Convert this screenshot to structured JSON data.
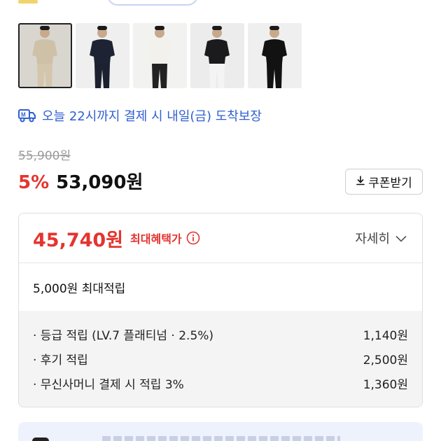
{
  "product": {
    "thumbnails": [
      {
        "name": "thumbnail-1",
        "selected": true,
        "shirt": "#cfc1a8",
        "pants": "#d3c6ad",
        "bg": "#d9d6cf"
      },
      {
        "name": "thumbnail-2",
        "selected": false,
        "shirt": "#1d2333",
        "pants": "#1c2130",
        "bg": "#efefef"
      },
      {
        "name": "thumbnail-3",
        "selected": false,
        "shirt": "#f3f1ec",
        "pants": "#222",
        "bg": "#f2f2f0"
      },
      {
        "name": "thumbnail-4",
        "selected": false,
        "shirt": "#1b1b1d",
        "pants": "#f4f4f4",
        "bg": "#ececec"
      },
      {
        "name": "thumbnail-5",
        "selected": false,
        "shirt": "#121212",
        "pants": "#121212",
        "bg": "#efefef"
      }
    ],
    "delivery_text": "오늘 22시까지 결제 시 내일(금) 도착보장",
    "original_price": "55,900원",
    "discount_rate": "5%",
    "sale_price": "53,090원",
    "coupon_label": "쿠폰받기"
  },
  "benefit": {
    "max_price": "45,740원",
    "max_label": "최대혜택가",
    "detail_label": "자세히",
    "points_total": "5,000원 최대적립",
    "items": [
      {
        "label": "· 등급 적립 (LV.7 플래티넘 · 2.5%)",
        "value": "1,140원"
      },
      {
        "label": "· 후기 적립",
        "value": "2,500원"
      },
      {
        "label": "· 무신사머니 결제 시 적립 3%",
        "value": "1,360원"
      }
    ]
  },
  "colors": {
    "accent_red": "#e5342f",
    "link_blue": "#2f5fd1"
  }
}
